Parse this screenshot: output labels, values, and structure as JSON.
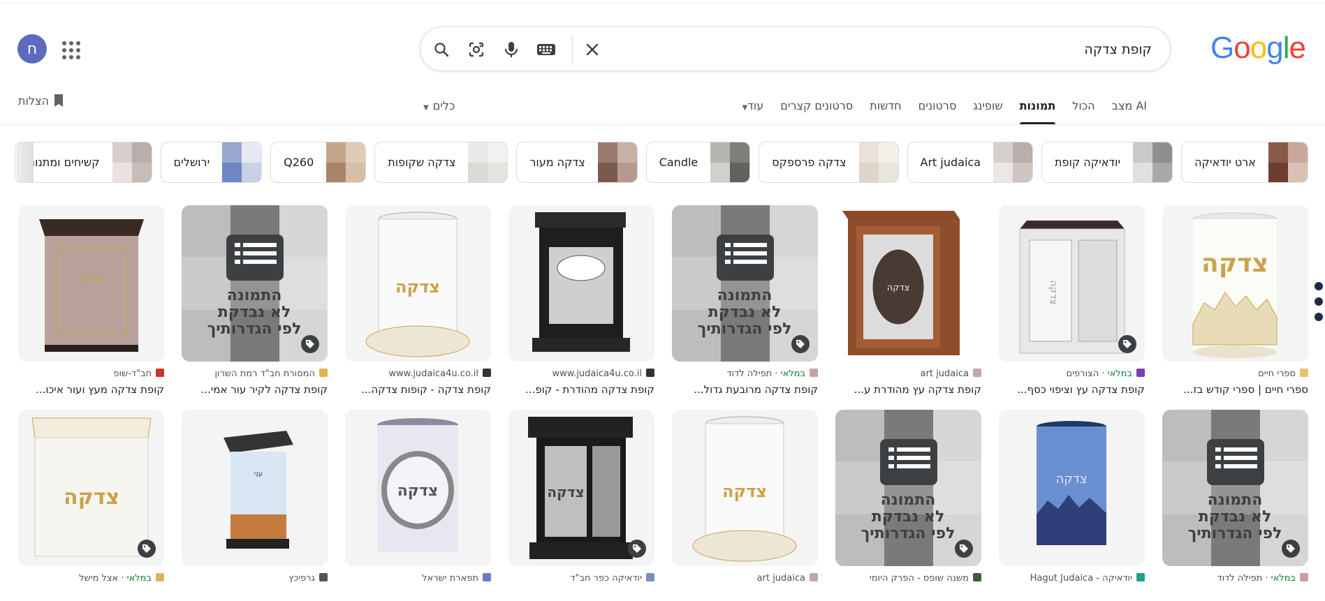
{
  "user": {
    "avatar_letter": "ח"
  },
  "search": {
    "query": "קופת צדקה"
  },
  "logo": {
    "letters": [
      "G",
      "o",
      "o",
      "g",
      "l",
      "e"
    ],
    "colors": [
      "#4285f4",
      "#ea4335",
      "#fbbc05",
      "#4285f4",
      "#34a853",
      "#ea4335"
    ]
  },
  "tabs": [
    {
      "label": "מצב AI"
    },
    {
      "label": "הכול"
    },
    {
      "label": "תמונות",
      "active": true
    },
    {
      "label": "שופינג"
    },
    {
      "label": "סרטונים"
    },
    {
      "label": "חדשות"
    },
    {
      "label": "סרטונים קצרים"
    },
    {
      "label": "עוד"
    }
  ],
  "tools_label": "כלים",
  "saves_label": "הצלות",
  "chips": [
    {
      "label": "ארט יודאיקה",
      "colors": [
        "#8a5a4a",
        "#c9a79a",
        "#6b3e30",
        "#d9c2b5"
      ]
    },
    {
      "label": "יודאיקה קופת",
      "colors": [
        "#c9c9c9",
        "#8f8f8f",
        "#e0e0e0",
        "#a9a9a9"
      ]
    },
    {
      "label": "Art judaica",
      "colors": [
        "#d6cfcd",
        "#b8aeac",
        "#ece7e5",
        "#cfc6c3"
      ]
    },
    {
      "label": "צדקה פרספקס",
      "colors": [
        "#e9e2d8",
        "#f3efe9",
        "#ddd5c8",
        "#eae6df"
      ]
    },
    {
      "label": "Candle",
      "colors": [
        "#b5b5b0",
        "#7d7f79",
        "#d0d1cc",
        "#61635e"
      ]
    },
    {
      "label": "צדקה מעור",
      "colors": [
        "#9b7b6f",
        "#c8b0a6",
        "#7a5a4e",
        "#b69a8e"
      ]
    },
    {
      "label": "צדקה שקופות",
      "colors": [
        "#e8e8e6",
        "#f2f2f0",
        "#d9d9d6",
        "#e4e4e1"
      ]
    },
    {
      "label": "Q260",
      "colors": [
        "#c3a58c",
        "#e0cbb7",
        "#a98468",
        "#d7bfa7"
      ]
    },
    {
      "label": "ירושלים",
      "colors": [
        "#9aa8d0",
        "#e6e9f2",
        "#6f86c6",
        "#c9d1e7"
      ]
    },
    {
      "label": "קשיחים ומתנות",
      "colors": [
        "#d8cfcd",
        "#b9aeab",
        "#e9e2e0",
        "#c8bcb9"
      ]
    }
  ],
  "results_row1": [
    {
      "source": "ספרי חיים",
      "source_color": "#e8c070",
      "buy": false,
      "title": "ספרי חיים | ספרי קודש בז...",
      "art": "tin",
      "tag": false
    },
    {
      "source": "הצורפים",
      "source_color": "#7b3fb0",
      "buy": true,
      "title": "קופת צדקה עץ וציפוי כסף...",
      "art": "silverbox",
      "tag": true
    },
    {
      "source": "art judaica",
      "source_color": "#c5a6a6",
      "buy": false,
      "title": "קופת צדקה עץ מהודרת ע...",
      "art": "woodbox",
      "tag": false
    },
    {
      "source": "תפילה לדוד",
      "source_color": "#c9a0a0",
      "buy": true,
      "title": "קופת צדקה מרובעת גדול...",
      "art": "unverified",
      "tag": true
    },
    {
      "source": "www.judaica4u.co.il",
      "source_color": "#333333",
      "buy": false,
      "title": "קופת צדקה מהודרת - קופ...",
      "art": "blackbox",
      "tag": false
    },
    {
      "source": "www.judaica4u.co.il",
      "source_color": "#333333",
      "buy": false,
      "title": "קופת צדקה - קופות צדקה...",
      "art": "clear",
      "tag": false
    },
    {
      "source": "המסורת חב\"ד רמת השרון",
      "source_color": "#e5b34b",
      "buy": false,
      "title": "קופת צדקה לקיר עור אמי...",
      "art": "unverified2",
      "tag": true
    },
    {
      "source": "חב\"ד-שופ",
      "source_color": "#c0392b",
      "buy": false,
      "title": "קופת צדקה מעץ ועור איכו...",
      "art": "leatherbox",
      "tag": false
    }
  ],
  "results_row2": [
    {
      "source": "תפילה לדוד",
      "source_color": "#c9a0a0",
      "buy": true,
      "art": "unverified",
      "tag": true
    },
    {
      "source": "יודאיקה - Hagut Judaica",
      "source_color": "#1aa38a",
      "buy": false,
      "art": "bluecyl",
      "tag": false
    },
    {
      "source": "משנה שופס - הפרק היומי",
      "source_color": "#3d5c3d",
      "buy": false,
      "art": "unverified3",
      "tag": true
    },
    {
      "source": "art judaica",
      "source_color": "#c5a6a6",
      "buy": false,
      "art": "clear2",
      "tag": false
    },
    {
      "source": "יודאיקה כפר חב\"ד",
      "source_color": "#7a8fb5",
      "buy": false,
      "art": "blackbox2",
      "tag": true
    },
    {
      "source": "תפארת ישראל",
      "source_color": "#6a7ac9",
      "buy": false,
      "art": "tin2",
      "tag": false
    },
    {
      "source": "גרפיכץ",
      "source_color": "#555555",
      "buy": false,
      "art": "printbox",
      "tag": false
    },
    {
      "source": "אצל מישל",
      "source_color": "#d9b46a",
      "buy": true,
      "art": "acrylic",
      "tag": true
    }
  ],
  "buy_label": "במלאי",
  "unverified_text": [
    "התמונה",
    "לא נבדקת",
    "לפי הגדרותיך"
  ],
  "tzedaka_word": "צדקה"
}
